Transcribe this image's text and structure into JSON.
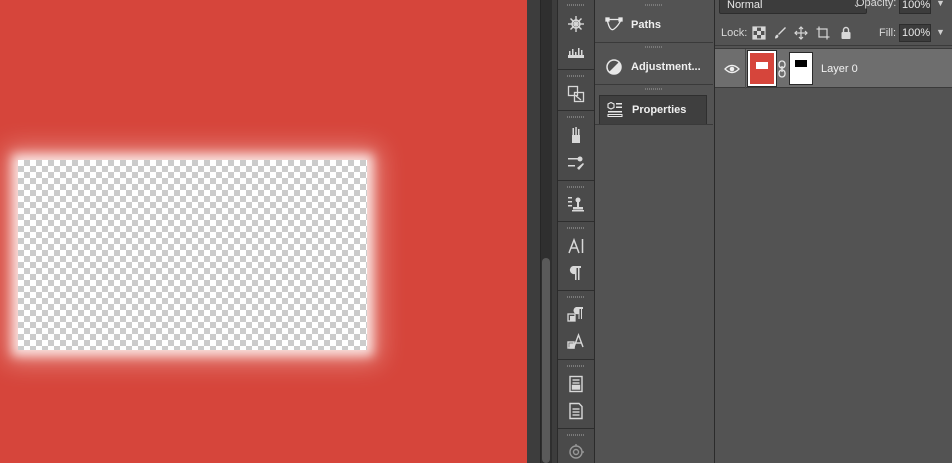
{
  "canvas": {
    "background_color": "#d6453b"
  },
  "icon_strip": {
    "icons": [
      "navigator-icon",
      "histogram-icon",
      "clone-source-icon",
      "brushes-icon",
      "brush-settings-icon",
      "tool-presets-icon",
      "character-icon",
      "paragraph-icon",
      "paragraph-styles-icon",
      "character-styles-icon",
      "notes-icon",
      "info-icon",
      "3d-icon"
    ]
  },
  "panels": {
    "tabs": [
      {
        "label": "Paths",
        "icon": "paths-icon"
      },
      {
        "label": "Adjustment...",
        "icon": "adjustments-icon"
      },
      {
        "label": "Properties",
        "icon": "properties-icon"
      }
    ]
  },
  "layers": {
    "blend_mode": "Normal",
    "opacity_label": "Opacity:",
    "opacity_value": "100%",
    "lock_label": "Lock:",
    "fill_label": "Fill:",
    "fill_value": "100%",
    "lock_icons": [
      "lock-transparent-icon",
      "lock-image-icon",
      "lock-position-icon",
      "lock-artboard-icon",
      "lock-all-icon"
    ],
    "layer": {
      "name": "Layer 0",
      "visible": true,
      "thumbnail_color": "#d6453b",
      "has_mask": true
    }
  },
  "colors": {
    "accent_red": "#d6453b",
    "panel_bg": "#535353",
    "selected_row": "#6e6e6e"
  }
}
